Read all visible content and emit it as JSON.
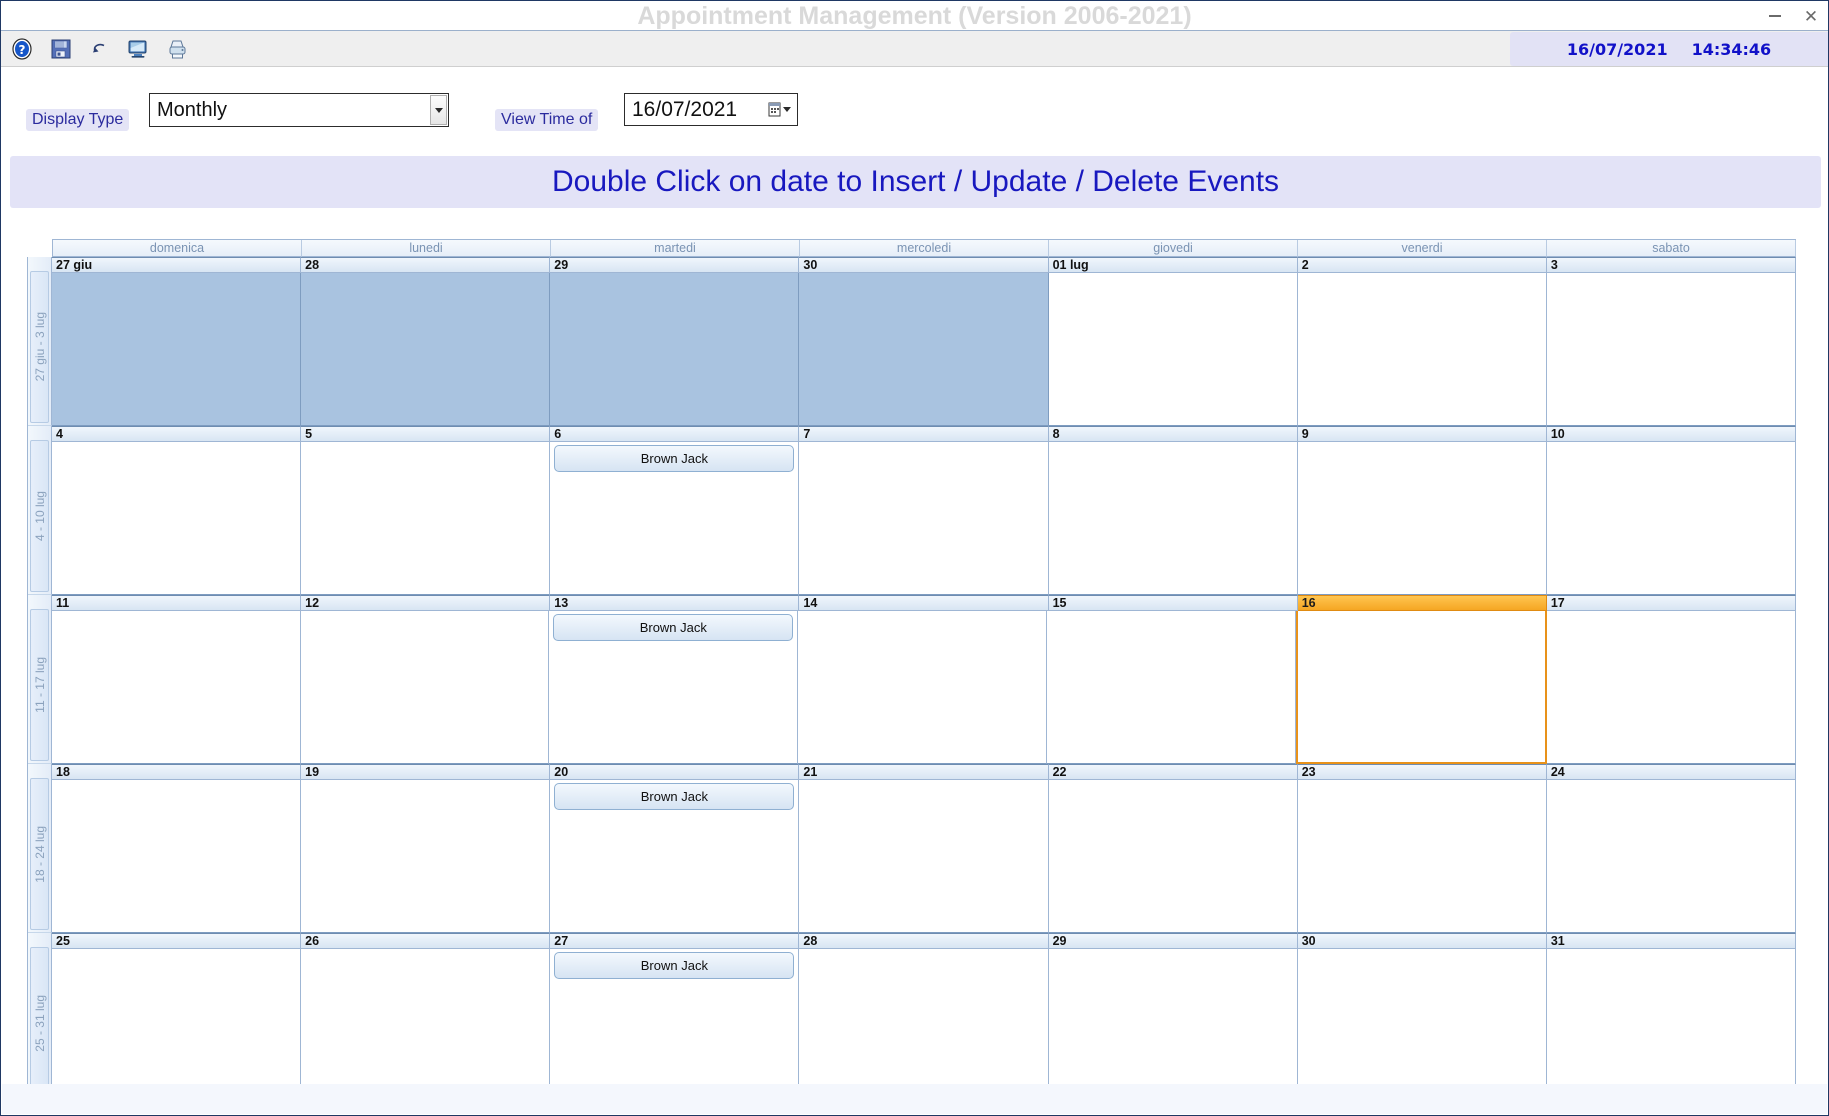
{
  "window": {
    "title": "Appointment Management (Version 2006-2021)",
    "minimize_label": "",
    "close_label": "✕"
  },
  "toolbar": {
    "icons": [
      {
        "name": "help-icon",
        "label": "?"
      },
      {
        "name": "save-icon",
        "label": "Save"
      },
      {
        "name": "undo-icon",
        "label": "Undo"
      },
      {
        "name": "screen-icon",
        "label": "Preview"
      },
      {
        "name": "printer-icon",
        "label": "Print"
      }
    ],
    "clock": {
      "date": "16/07/2021",
      "time": "14:34:46"
    }
  },
  "controls": {
    "display_type_label": "Display Type",
    "display_type_value": "Monthly",
    "view_time_label": "View Time of",
    "view_time_value": "16/07/2021"
  },
  "banner": {
    "text": "Double Click on date to Insert / Update / Delete Events"
  },
  "calendar": {
    "day_names": [
      "domenica",
      "lunedi",
      "martedi",
      "mercoledi",
      "giovedi",
      "venerdi",
      "sabato"
    ],
    "colors": {
      "selection_accent": "#f5a623",
      "out_of_month": "#a9c3e0",
      "grid_line": "#9fb6d4",
      "header_text": "#7a93b3"
    },
    "weeks": [
      {
        "label": "27 giu - 3 lug",
        "days": [
          {
            "num": "27 giu",
            "other": true,
            "selected": false,
            "events": []
          },
          {
            "num": "28",
            "other": true,
            "selected": false,
            "events": []
          },
          {
            "num": "29",
            "other": true,
            "selected": false,
            "events": []
          },
          {
            "num": "30",
            "other": true,
            "selected": false,
            "events": []
          },
          {
            "num": "01 lug",
            "other": false,
            "selected": false,
            "events": []
          },
          {
            "num": "2",
            "other": false,
            "selected": false,
            "events": []
          },
          {
            "num": "3",
            "other": false,
            "selected": false,
            "events": []
          }
        ]
      },
      {
        "label": "4 - 10 lug",
        "days": [
          {
            "num": "4",
            "other": false,
            "selected": false,
            "events": []
          },
          {
            "num": "5",
            "other": false,
            "selected": false,
            "events": []
          },
          {
            "num": "6",
            "other": false,
            "selected": false,
            "events": [
              "Brown Jack"
            ]
          },
          {
            "num": "7",
            "other": false,
            "selected": false,
            "events": []
          },
          {
            "num": "8",
            "other": false,
            "selected": false,
            "events": []
          },
          {
            "num": "9",
            "other": false,
            "selected": false,
            "events": []
          },
          {
            "num": "10",
            "other": false,
            "selected": false,
            "events": []
          }
        ]
      },
      {
        "label": "11 - 17 lug",
        "days": [
          {
            "num": "11",
            "other": false,
            "selected": false,
            "events": []
          },
          {
            "num": "12",
            "other": false,
            "selected": false,
            "events": []
          },
          {
            "num": "13",
            "other": false,
            "selected": false,
            "events": [
              "Brown Jack"
            ]
          },
          {
            "num": "14",
            "other": false,
            "selected": false,
            "events": []
          },
          {
            "num": "15",
            "other": false,
            "selected": false,
            "events": []
          },
          {
            "num": "16",
            "other": false,
            "selected": true,
            "events": []
          },
          {
            "num": "17",
            "other": false,
            "selected": false,
            "events": []
          }
        ]
      },
      {
        "label": "18 - 24 lug",
        "days": [
          {
            "num": "18",
            "other": false,
            "selected": false,
            "events": []
          },
          {
            "num": "19",
            "other": false,
            "selected": false,
            "events": []
          },
          {
            "num": "20",
            "other": false,
            "selected": false,
            "events": [
              "Brown Jack"
            ]
          },
          {
            "num": "21",
            "other": false,
            "selected": false,
            "events": []
          },
          {
            "num": "22",
            "other": false,
            "selected": false,
            "events": []
          },
          {
            "num": "23",
            "other": false,
            "selected": false,
            "events": []
          },
          {
            "num": "24",
            "other": false,
            "selected": false,
            "events": []
          }
        ]
      },
      {
        "label": "25 - 31 lug",
        "days": [
          {
            "num": "25",
            "other": false,
            "selected": false,
            "events": []
          },
          {
            "num": "26",
            "other": false,
            "selected": false,
            "events": []
          },
          {
            "num": "27",
            "other": false,
            "selected": false,
            "events": [
              "Brown Jack"
            ]
          },
          {
            "num": "28",
            "other": false,
            "selected": false,
            "events": []
          },
          {
            "num": "29",
            "other": false,
            "selected": false,
            "events": []
          },
          {
            "num": "30",
            "other": false,
            "selected": false,
            "events": []
          },
          {
            "num": "31",
            "other": false,
            "selected": false,
            "events": []
          }
        ]
      }
    ]
  }
}
